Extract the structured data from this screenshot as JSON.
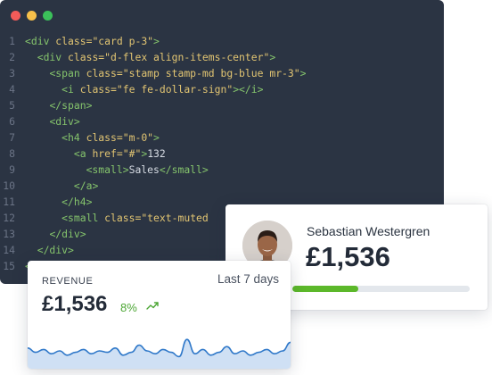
{
  "editor": {
    "lines": [
      {
        "num": "1",
        "indent": "",
        "tokens": [
          [
            "tag",
            "<div "
          ],
          [
            "attr",
            "class="
          ],
          [
            "str",
            "\"card p-3\""
          ],
          [
            "tag",
            ">"
          ]
        ]
      },
      {
        "num": "2",
        "indent": "  ",
        "tokens": [
          [
            "tag",
            "<div "
          ],
          [
            "attr",
            "class="
          ],
          [
            "str",
            "\"d-flex align-items-center\""
          ],
          [
            "tag",
            ">"
          ]
        ]
      },
      {
        "num": "3",
        "indent": "    ",
        "tokens": [
          [
            "tag",
            "<span "
          ],
          [
            "attr",
            "class="
          ],
          [
            "str",
            "\"stamp stamp-md bg-blue mr-3\""
          ],
          [
            "tag",
            ">"
          ]
        ]
      },
      {
        "num": "4",
        "indent": "      ",
        "tokens": [
          [
            "tag",
            "<i "
          ],
          [
            "attr",
            "class="
          ],
          [
            "str",
            "\"fe fe-dollar-sign\""
          ],
          [
            "tag",
            "></i>"
          ]
        ]
      },
      {
        "num": "5",
        "indent": "    ",
        "tokens": [
          [
            "tag",
            "</span>"
          ]
        ]
      },
      {
        "num": "6",
        "indent": "    ",
        "tokens": [
          [
            "tag",
            "<div>"
          ]
        ]
      },
      {
        "num": "7",
        "indent": "      ",
        "tokens": [
          [
            "tag",
            "<h4 "
          ],
          [
            "attr",
            "class="
          ],
          [
            "str",
            "\"m-0\""
          ],
          [
            "tag",
            ">"
          ]
        ]
      },
      {
        "num": "8",
        "indent": "        ",
        "tokens": [
          [
            "tag",
            "<a "
          ],
          [
            "attr",
            "href="
          ],
          [
            "str",
            "\"#\""
          ],
          [
            "tag",
            ">"
          ],
          [
            "txt",
            "132"
          ]
        ]
      },
      {
        "num": "9",
        "indent": "          ",
        "tokens": [
          [
            "tag",
            "<small>"
          ],
          [
            "txt",
            "Sales"
          ],
          [
            "tag",
            "</small>"
          ]
        ]
      },
      {
        "num": "10",
        "indent": "        ",
        "tokens": [
          [
            "tag",
            "</a>"
          ]
        ]
      },
      {
        "num": "11",
        "indent": "      ",
        "tokens": [
          [
            "tag",
            "</h4>"
          ]
        ]
      },
      {
        "num": "12",
        "indent": "      ",
        "tokens": [
          [
            "tag",
            "<small "
          ],
          [
            "attr",
            "class="
          ],
          [
            "str",
            "\"text-muted"
          ]
        ]
      },
      {
        "num": "13",
        "indent": "    ",
        "tokens": [
          [
            "tag",
            "</div>"
          ]
        ]
      },
      {
        "num": "14",
        "indent": "  ",
        "tokens": [
          [
            "tag",
            "</div>"
          ]
        ]
      },
      {
        "num": "15",
        "indent": "",
        "tokens": [
          [
            "tag",
            "</d"
          ]
        ]
      }
    ]
  },
  "profile": {
    "name": "Sebastian Westergren",
    "value": "£1,536",
    "progress": 0.37,
    "progress_color": "#5cb82a"
  },
  "revenue": {
    "label": "REVENUE",
    "range": "Last 7 days",
    "value": "£1,536",
    "change": "8%",
    "trend_icon": "trending-up-icon",
    "sparkline": [
      22,
      19,
      21,
      18,
      20,
      17,
      19,
      21,
      18,
      20,
      19,
      22,
      17,
      19,
      24,
      20,
      18,
      21,
      19,
      16,
      28,
      18,
      21,
      17,
      19,
      23,
      18,
      20,
      17,
      19,
      21,
      18,
      20,
      26
    ]
  },
  "colors": {
    "editor_bg": "#2b3443",
    "accent_green": "#4ca634",
    "sparkline": "#2f78c9"
  }
}
